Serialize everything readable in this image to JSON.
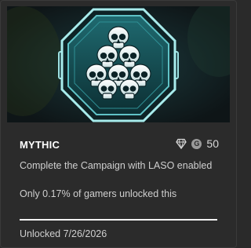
{
  "achievement": {
    "title": "MYTHIC",
    "description": "Complete the Campaign with LASO enabled",
    "rarity_text": "Only 0.17% of gamers unlocked this",
    "gamerscore": "50",
    "gamerscore_glyph": "G",
    "unlocked_text": "Unlocked 7/26/2026",
    "progress_fraction": 1.0,
    "icons": {
      "artwork": "skull-pyramid-badge-icon",
      "gem": "gem-icon",
      "gamerscore": "gamerscore-icon"
    }
  },
  "colors": {
    "card_background": "#2b2b2b",
    "badge_teal": "#7fd6d6",
    "badge_dark": "#0f2e33",
    "text_primary": "#ffffff",
    "text_secondary": "#cfcfcf"
  }
}
